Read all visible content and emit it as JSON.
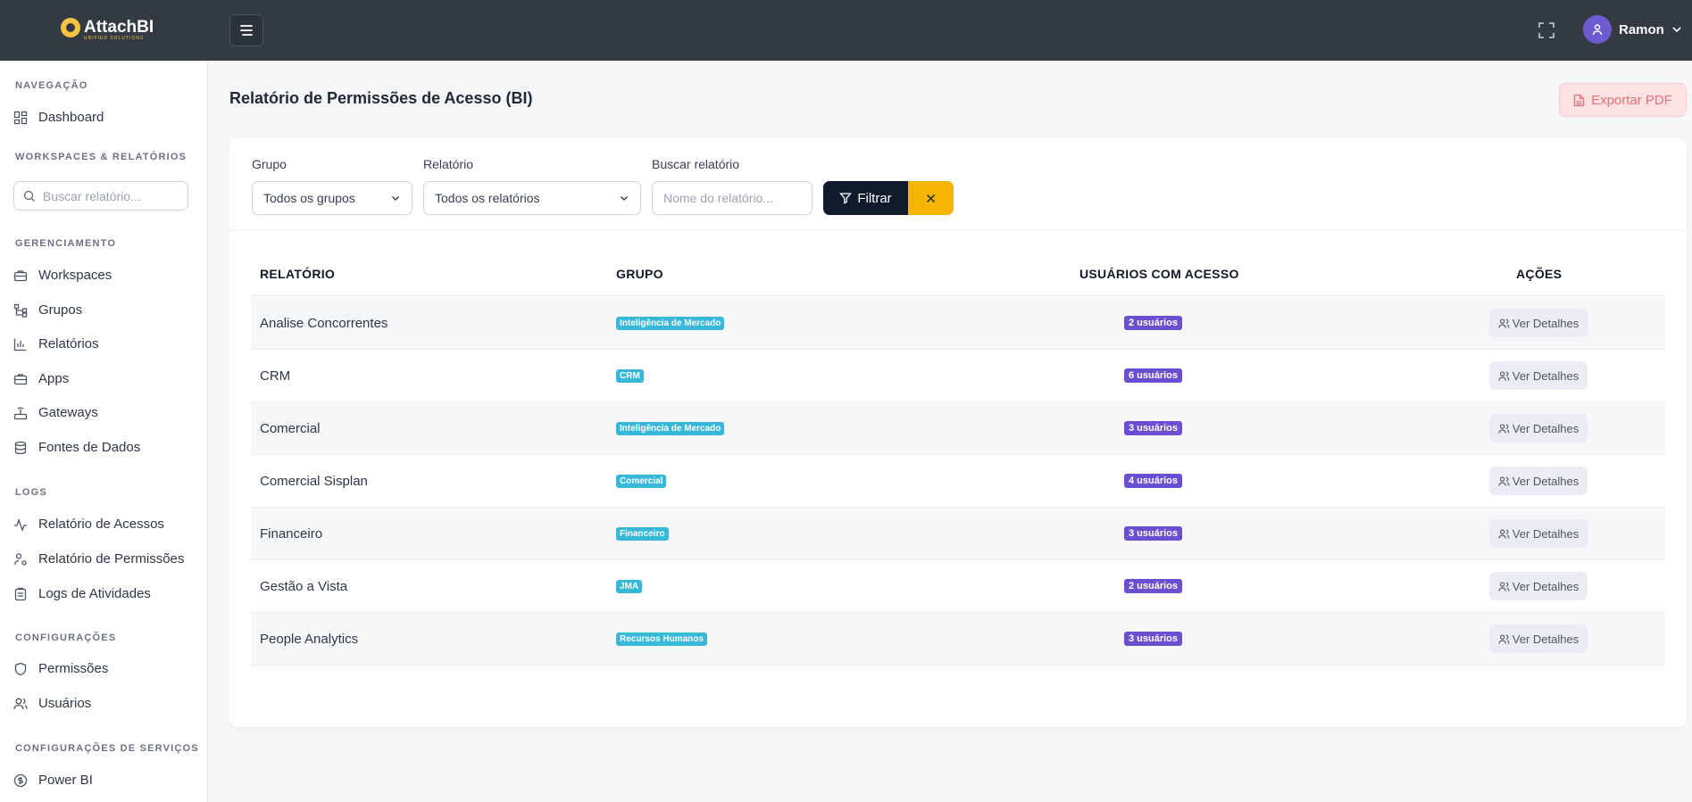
{
  "header": {
    "logo_text": "AttachBI",
    "logo_subtext": "UNIFIED SOLUTIONS",
    "user_name": "Ramon"
  },
  "sidebar": {
    "sections": [
      {
        "title": "NAVEGAÇÃO"
      },
      {
        "title": "WORKSPACES & RELATÓRIOS"
      },
      {
        "title": "GERENCIAMENTO"
      },
      {
        "title": "LOGS"
      },
      {
        "title": "CONFIGURAÇÕES"
      },
      {
        "title": "CONFIGURAÇÕES DE SERVIÇOS"
      }
    ],
    "search_placeholder": "Buscar relatório...",
    "items": [
      {
        "label": "Dashboard",
        "icon": "dashboard-icon"
      },
      {
        "label": "Workspaces",
        "icon": "briefcase-icon"
      },
      {
        "label": "Grupos",
        "icon": "hierarchy-icon"
      },
      {
        "label": "Relatórios",
        "icon": "chart-icon"
      },
      {
        "label": "Apps",
        "icon": "briefcase-icon"
      },
      {
        "label": "Gateways",
        "icon": "router-icon"
      },
      {
        "label": "Fontes de Dados",
        "icon": "database-icon"
      },
      {
        "label": "Relatório de Acessos",
        "icon": "activity-icon"
      },
      {
        "label": "Relatório de Permissões",
        "icon": "user-key-icon"
      },
      {
        "label": "Logs de Atividades",
        "icon": "clipboard-icon"
      },
      {
        "label": "Permissões",
        "icon": "shield-icon"
      },
      {
        "label": "Usuários",
        "icon": "users-icon"
      },
      {
        "label": "Power BI",
        "icon": "dollar-circle-icon"
      }
    ]
  },
  "page": {
    "title": "Relatório de Permissões de Acesso (BI)",
    "export_label": "Exportar PDF"
  },
  "filters": {
    "group_label": "Grupo",
    "group_value": "Todos os grupos",
    "report_label": "Relatório",
    "report_value": "Todos os relatórios",
    "search_label": "Buscar relatório",
    "search_placeholder": "Nome do relatório...",
    "filter_button": "Filtrar"
  },
  "table": {
    "headers": [
      "RELATÓRIO",
      "GRUPO",
      "USUÁRIOS COM ACESSO",
      "AÇÕES"
    ],
    "action_label": "Ver Detalhes",
    "rows": [
      {
        "report": "Analise Concorrentes",
        "group": "Inteligência de Mercado",
        "users": "2 usuários"
      },
      {
        "report": "CRM",
        "group": "CRM",
        "users": "6 usuários"
      },
      {
        "report": "Comercial",
        "group": "Inteligência de Mercado",
        "users": "3 usuários"
      },
      {
        "report": "Comercial Sisplan",
        "group": "Comercial",
        "users": "4 usuários"
      },
      {
        "report": "Financeiro",
        "group": "Financeiro",
        "users": "3 usuários"
      },
      {
        "report": "Gestão a Vista",
        "group": "JMA",
        "users": "2 usuários"
      },
      {
        "report": "People Analytics",
        "group": "Recursos Humanos",
        "users": "3 usuários"
      }
    ]
  },
  "colors": {
    "topbar": "#343a44",
    "group_badge": "#37b8d8",
    "users_badge": "#6a4fd3",
    "filter_button": "#0f1b2d",
    "clear_button": "#f4b400",
    "export_button_bg": "#fde2e4"
  }
}
